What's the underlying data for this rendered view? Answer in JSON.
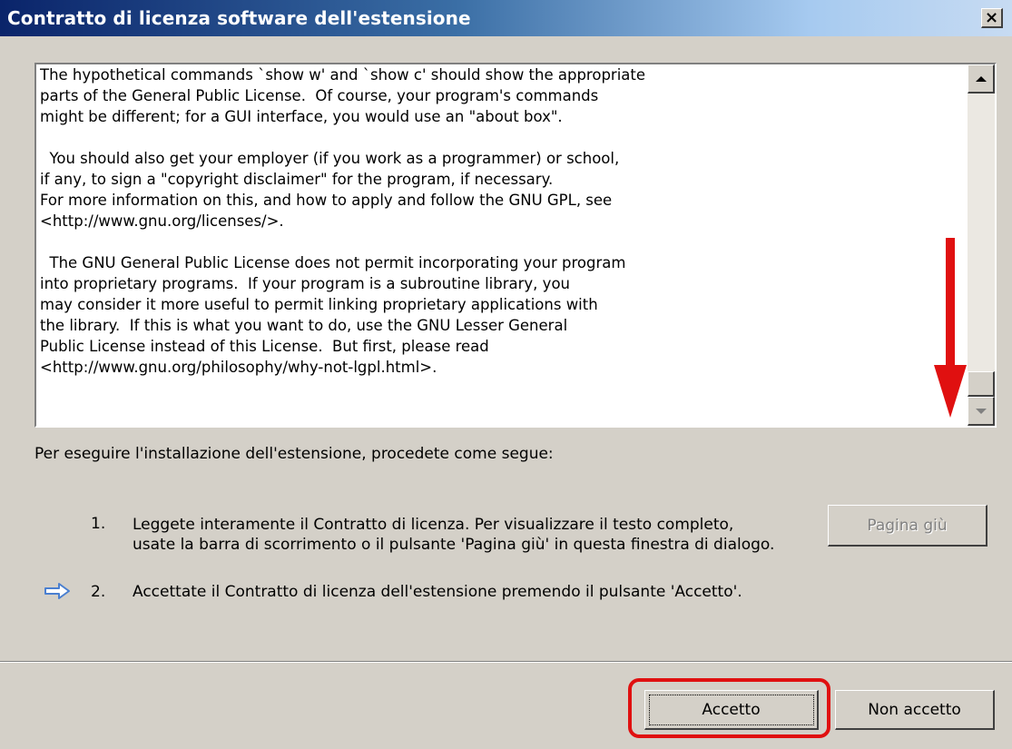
{
  "window": {
    "title": "Contratto di licenza software dell'estensione",
    "close_glyph": "×",
    "title_bar_color": "#0a246a"
  },
  "license": {
    "text": "The hypothetical commands `show w' and `show c' should show the appropriate\nparts of the General Public License.  Of course, your program's commands\nmight be different; for a GUI interface, you would use an \"about box\".\n\n  You should also get your employer (if you work as a programmer) or school,\nif any, to sign a \"copyright disclaimer\" for the program, if necessary.\nFor more information on this, and how to apply and follow the GNU GPL, see\n<http://www.gnu.org/licenses/>.\n\n  The GNU General Public License does not permit incorporating your program\ninto proprietary programs.  If your program is a subroutine library, you\nmay consider it more useful to permit linking proprietary applications with\nthe library.  If this is what you want to do, use the GNU Lesser General\nPublic License instead of this License.  But first, please read\n<http://www.gnu.org/philosophy/why-not-lgpl.html>."
  },
  "annotation": {
    "arrow_icon": "down-arrow-icon",
    "arrow_color": "#e01010"
  },
  "instructions": {
    "intro": "Per eseguire l'installazione dell'estensione, procedete come segue:",
    "step1_number": "1.",
    "step1_line1": "Leggete interamente il Contratto di licenza. Per visualizzare il testo completo,",
    "step1_line2": "usate la barra di scorrimento o il pulsante 'Pagina giù' in questa finestra di dialogo.",
    "step2_number": "2.",
    "step2_text": "Accettate il Contratto di licenza dell'estensione premendo il pulsante 'Accetto'.",
    "current_step_icon": "right-arrow-icon",
    "current_step_color": "#4a7fd0"
  },
  "buttons": {
    "page_down": "Pagina giù",
    "accept": "Accetto",
    "decline": "Non accetto",
    "highlight_color": "#e01010"
  }
}
